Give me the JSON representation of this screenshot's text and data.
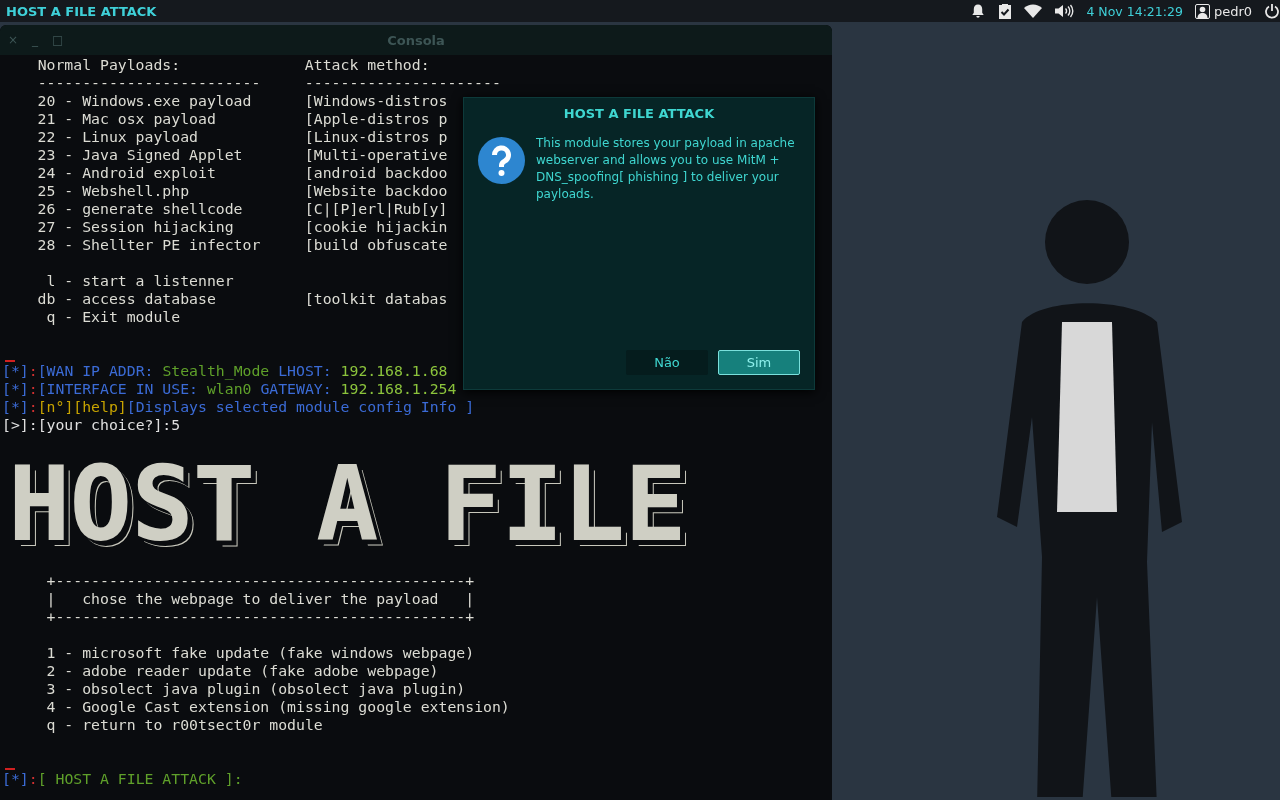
{
  "top_bar": {
    "title": "HOST A FILE ATTACK",
    "clock": "4 Nov 14:21:29",
    "user": "pedr0"
  },
  "terminal": {
    "title": "Consola",
    "controls": [
      "×",
      "_",
      "□"
    ],
    "headers": [
      "Normal Payloads:",
      "Attack method:"
    ],
    "rules": [
      "-------------------------",
      "----------------------"
    ],
    "payloads": [
      {
        "key": "20",
        "label": "- Windows.exe payload",
        "method": "[Windows-distros"
      },
      {
        "key": "21",
        "label": "- Mac osx payload",
        "method": "[Apple-distros p"
      },
      {
        "key": "22",
        "label": "- Linux payload",
        "method": "[Linux-distros p"
      },
      {
        "key": "23",
        "label": "- Java Signed Applet",
        "method": "[Multi-operative"
      },
      {
        "key": "24",
        "label": "- Android exploit",
        "method": "[android backdoo"
      },
      {
        "key": "25",
        "label": "- Webshell.php",
        "method": "[Website backdoo"
      },
      {
        "key": "26",
        "label": "- generate shellcode",
        "method": "[C|[P]erl|Rub[y]"
      },
      {
        "key": "27",
        "label": "- Session hijacking",
        "method": "[cookie hijackin"
      },
      {
        "key": "28",
        "label": "- Shellter PE infector",
        "method": "[build obfuscate"
      }
    ],
    "extras": [
      {
        "key": "l",
        "label": "- start a listenner"
      },
      {
        "key": "db",
        "label": "- access database",
        "method": "[toolkit databas"
      },
      {
        "key": "q",
        "label": "- Exit module"
      }
    ],
    "status_lines": [
      [
        {
          "text": "[*]",
          "color": "#3b6bd6"
        },
        {
          "text": ":",
          "color": "#d03030"
        },
        {
          "text": "[WAN IP ADDR: ",
          "color": "#3b6bd6"
        },
        {
          "text": "Stealth_Mode",
          "color": "#5fa02a"
        },
        {
          "text": " LHOST: ",
          "color": "#3b6bd6"
        },
        {
          "text": "192.168.1.68",
          "color": "#8cc43c"
        }
      ],
      [
        {
          "text": "[*]",
          "color": "#3b6bd6"
        },
        {
          "text": ":",
          "color": "#d03030"
        },
        {
          "text": "[INTERFACE IN USE: ",
          "color": "#3b6bd6"
        },
        {
          "text": "wlan0",
          "color": "#5fa02a"
        },
        {
          "text": " GATEWAY: ",
          "color": "#3b6bd6"
        },
        {
          "text": "192.168.1.254",
          "color": "#8cc43c"
        }
      ],
      [
        {
          "text": "[*]",
          "color": "#3b6bd6"
        },
        {
          "text": ":",
          "color": "#d03030"
        },
        {
          "text": "[n°][help]",
          "color": "#c8a400"
        },
        {
          "text": "[Displays selected module config Info ]",
          "color": "#3b6bd6"
        }
      ],
      [
        {
          "text": "[>]:[your choice?]:5",
          "color": "#e0e0e0"
        }
      ]
    ],
    "banner": "HOST A FILE",
    "box": [
      "+----------------------------------------------+",
      "|   chose the webpage to deliver the payload   |",
      "+----------------------------------------------+"
    ],
    "options": [
      "1 - microsoft fake update (fake windows webpage)",
      "2 - adobe reader update (fake adobe webpage)",
      "3 - obsolect java plugin (obsolect java plugin)",
      "4 - Google Cast extension (missing google extension)",
      "q - return to r00tsect0r module"
    ],
    "prompt": [
      {
        "text": "[*]",
        "color": "#3b6bd6"
      },
      {
        "text": ":",
        "color": "#d03030"
      },
      {
        "text": "[ HOST A FILE ATTACK ]:",
        "color": "#5fa02a"
      }
    ]
  },
  "dialog": {
    "title": "HOST A FILE ATTACK",
    "message": "This module stores your payload in apache webserver and allows you to use MitM + DNS_spoofing[ phishing ] to deliver your payloads.",
    "buttons": [
      {
        "label": "Não",
        "selected": false
      },
      {
        "label": "Sim",
        "selected": true
      }
    ]
  }
}
